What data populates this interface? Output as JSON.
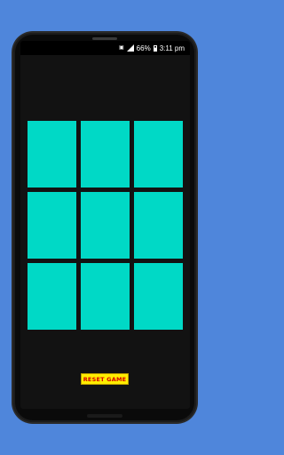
{
  "status_bar": {
    "sim_label": "▣",
    "battery_percent": "66%",
    "time": "3:11 pm"
  },
  "board": {
    "cells": [
      "",
      "",
      "",
      "",
      "",
      "",
      "",
      "",
      ""
    ],
    "cell_color": "#00d9c6"
  },
  "controls": {
    "reset_label": "RESET GAME",
    "reset_background": "#ffee00",
    "reset_text_color": "#d40000"
  },
  "colors": {
    "background": "#4f86db",
    "screen": "#121212"
  }
}
